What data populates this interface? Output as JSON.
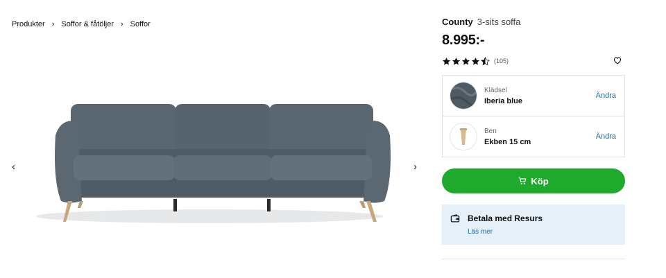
{
  "breadcrumb": {
    "items": [
      "Produkter",
      "Soffor & fåtöljer",
      "Soffor"
    ],
    "separator": ">"
  },
  "gallery": {
    "prev_icon": "chevron-left-icon",
    "next_icon": "chevron-right-icon",
    "arrow_prev": "‹",
    "arrow_next": "›"
  },
  "product": {
    "brand": "County",
    "subtitle": "3-sits soffa",
    "price": "8.995:-",
    "rating": 4.5,
    "review_count": "(105)"
  },
  "options": [
    {
      "label": "Klädsel",
      "value": "Iberia blue",
      "action": "Ändra"
    },
    {
      "label": "Ben",
      "value": "Ekben 15 cm",
      "action": "Ändra"
    }
  ],
  "buy": {
    "label": "Köp"
  },
  "resurs": {
    "title": "Betala med Resurs",
    "link": "Läs mer"
  },
  "colors": {
    "accent_green": "#1faa2d",
    "link_blue": "#1b6aa5",
    "info_bg": "#e5f0f9",
    "sofa_fabric": "#56626b"
  }
}
